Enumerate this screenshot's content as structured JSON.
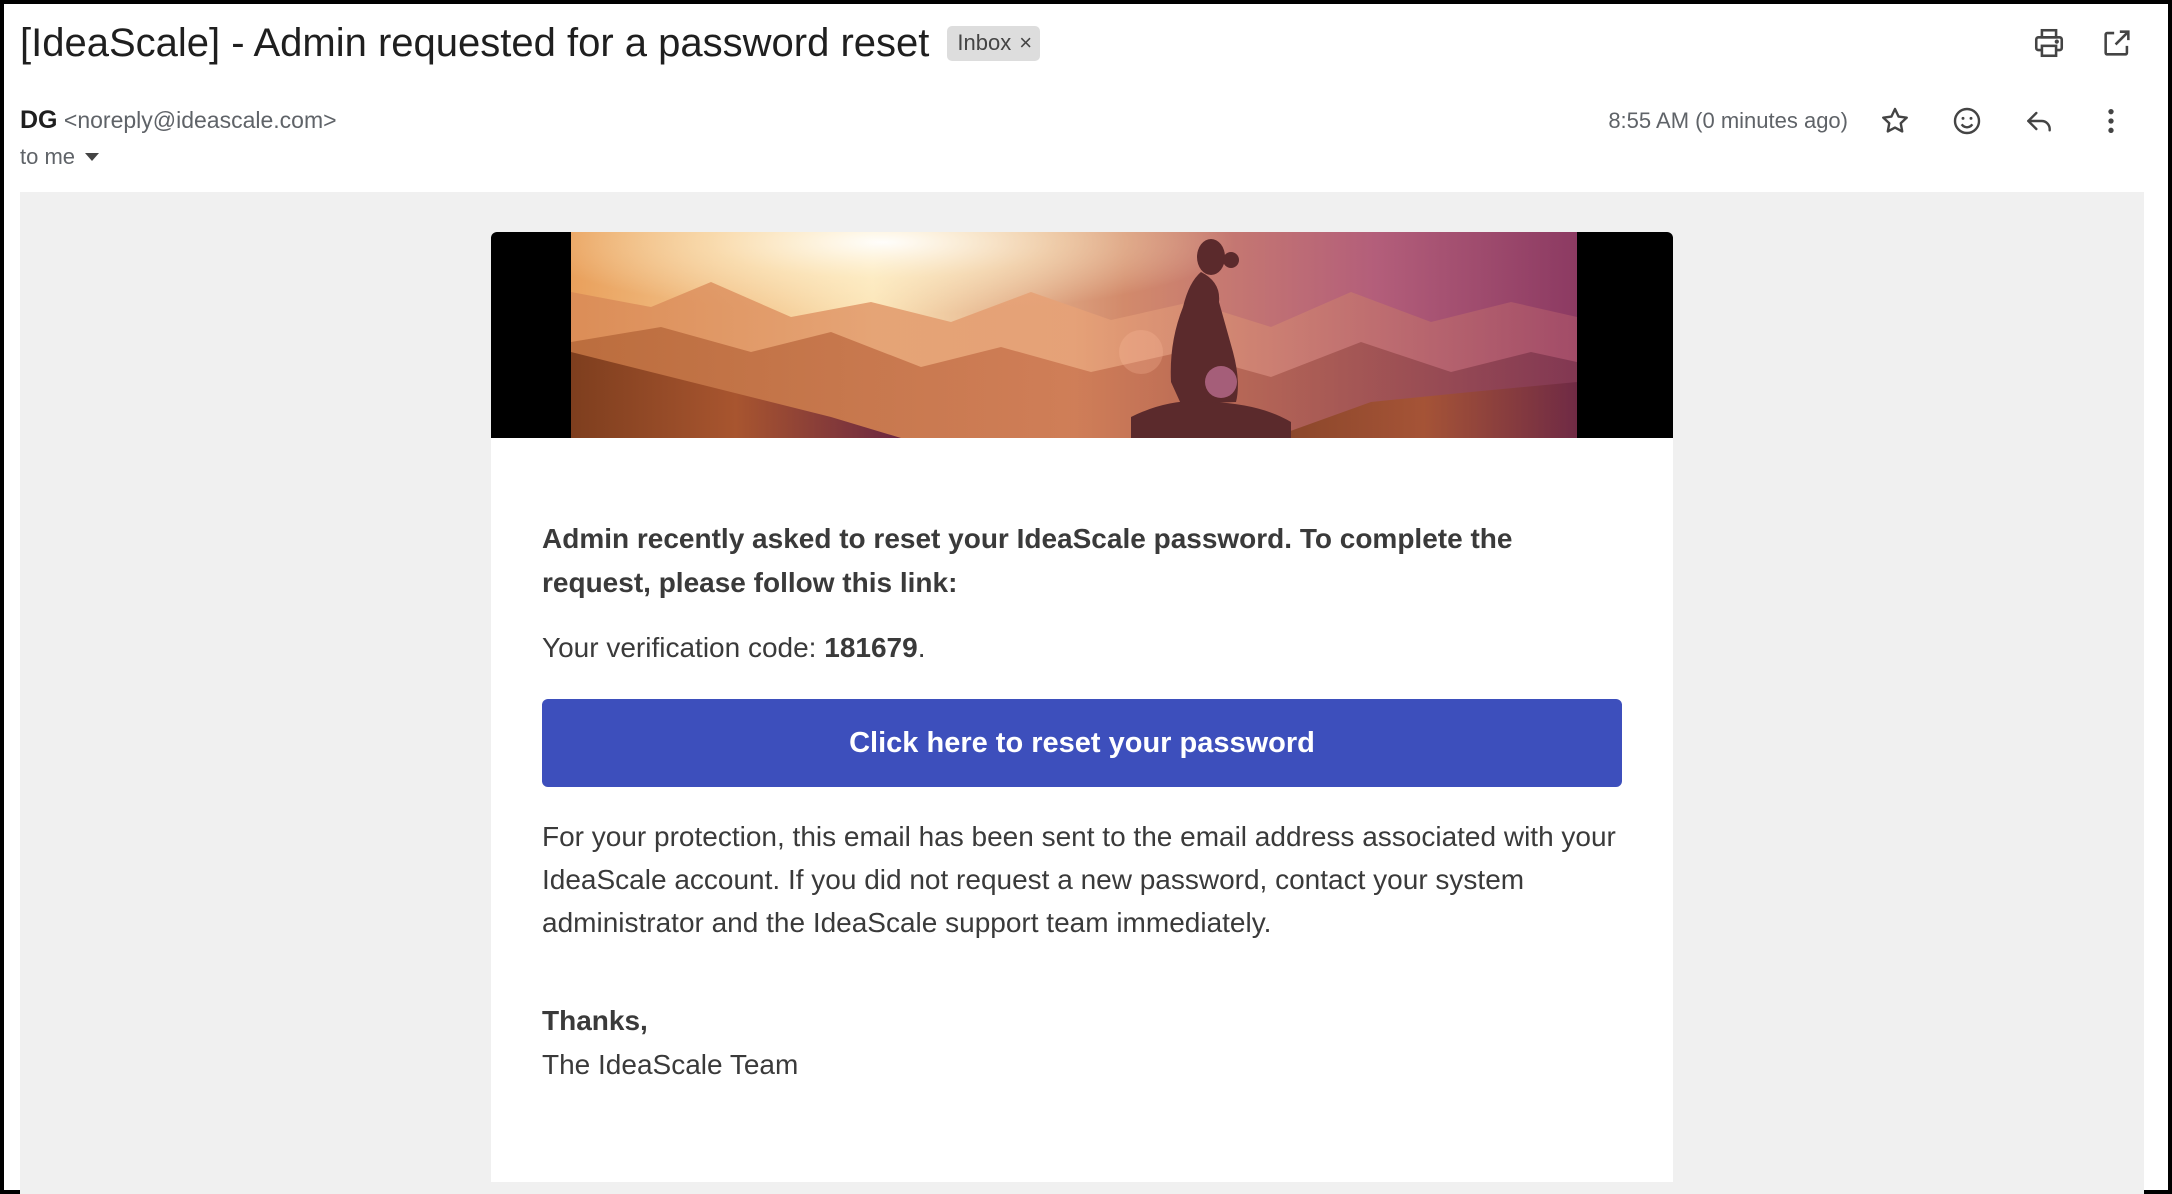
{
  "email": {
    "subject": "[IdeaScale] - Admin requested for a password reset",
    "label": "Inbox",
    "label_remove": "×",
    "sender_name": "DG",
    "sender_email": "<noreply@ideascale.com>",
    "to": "to me",
    "timestamp": "8:55 AM (0 minutes ago)"
  },
  "toolbar_icons": [
    "print-icon",
    "open-in-new-window-icon"
  ],
  "meta_icons": [
    "star-icon",
    "emoji-icon",
    "reply-icon",
    "more-vertical-icon"
  ],
  "body": {
    "intro": "Admin recently asked to reset your IdeaScale password. To complete the request, please follow this link:",
    "code_prefix": "Your verification code: ",
    "code": "181679",
    "code_suffix": ".",
    "button_label": "Click here to reset your password",
    "protection": "For your protection, this email has been sent to the email address associated with your IdeaScale account. If you did not request a new password, contact your system administrator and the IdeaScale support team immediately.",
    "thanks": "Thanks,",
    "signature": "The IdeaScale Team"
  },
  "colors": {
    "button": "#3d4fbc",
    "email_background": "#f0f0f0",
    "chip": "#dddddd"
  }
}
